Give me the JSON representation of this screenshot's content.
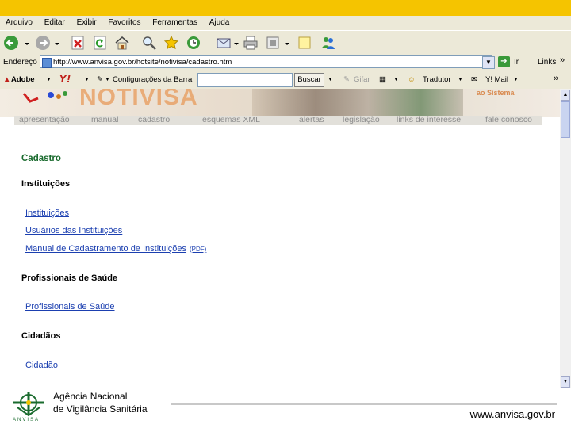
{
  "menu": [
    "Arquivo",
    "Editar",
    "Exibir",
    "Favoritos",
    "Ferramentas",
    "Ajuda"
  ],
  "address": {
    "label": "Endereço",
    "url": "http://www.anvisa.gov.br/hotsite/notivisa/cadastro.htm",
    "go": "Ir",
    "links": "Links",
    "chevron": "»"
  },
  "toolbar2": {
    "adobe": "Adobe",
    "yahoo": "Y!",
    "config": "Configurações da Barra",
    "buscar": "Buscar",
    "gifar": "Gifar",
    "tradutor": "Tradutor",
    "ymail": "Y! Mail",
    "chevron": "»"
  },
  "banner": {
    "logo": "NOTIVISA",
    "ao_sistema": "ao Sistema"
  },
  "nav": [
    "apresentação",
    "manual",
    "cadastro",
    "esquemas XML",
    "alertas",
    "legislação",
    "links de interesse",
    "fale conosco"
  ],
  "page": {
    "title": "Cadastro",
    "sections": {
      "instituicoes": {
        "heading": "Instituições",
        "links": [
          "Instituições",
          "Usuários das Instituições",
          "Manual de Cadastramento de Instituições"
        ],
        "pdf": "(PDF)"
      },
      "profissionais": {
        "heading": "Profissionais de Saúde",
        "links": [
          "Profissionais de Saúde"
        ]
      },
      "cidadaos": {
        "heading": "Cidadãos",
        "links": [
          "Cidadão"
        ]
      }
    }
  },
  "footer": {
    "agency_line1": "Agência Nacional",
    "agency_line2": "de Vigilância Sanitária",
    "site": "www.anvisa.gov.br",
    "logo_word": "ANVISA"
  },
  "colors": {
    "topbar": "#f5c400",
    "chrome": "#ece9d8",
    "link": "#1b3fb0",
    "title_green": "#1a6b2e"
  }
}
